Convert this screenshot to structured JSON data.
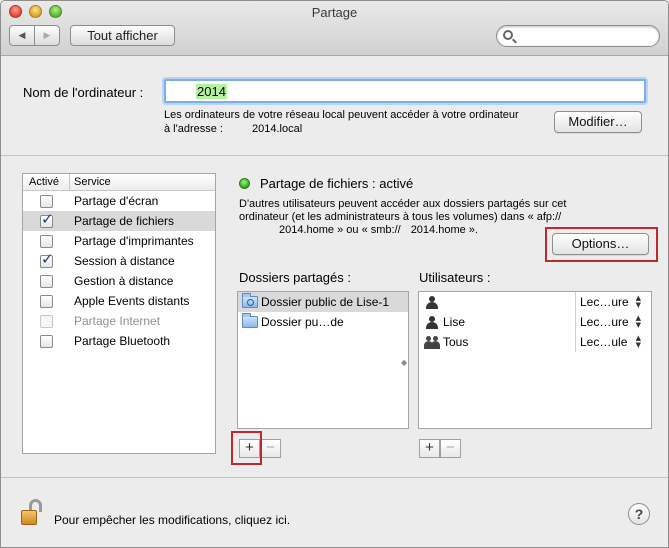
{
  "window": {
    "title": "Partage",
    "nav_back": "◀",
    "nav_forward": "▶",
    "show_all_label": "Tout afficher",
    "search_placeholder": ""
  },
  "computer_name": {
    "label": "Nom de l'ordinateur :",
    "value": "2014",
    "description": "Les ordinateurs de votre réseau local peuvent accéder à votre ordinateur à l'adresse :",
    "address": "2014.local",
    "modify_label": "Modifier…"
  },
  "services": {
    "col_active": "Activé",
    "col_service": "Service",
    "items": [
      {
        "label": "Partage d'écran",
        "checked": false,
        "selected": false,
        "disabled": false
      },
      {
        "label": "Partage de fichiers",
        "checked": true,
        "selected": true,
        "disabled": false
      },
      {
        "label": "Partage d'imprimantes",
        "checked": false,
        "selected": false,
        "disabled": false
      },
      {
        "label": "Session à distance",
        "checked": true,
        "selected": false,
        "disabled": false
      },
      {
        "label": "Gestion à distance",
        "checked": false,
        "selected": false,
        "disabled": false
      },
      {
        "label": "Apple Events distants",
        "checked": false,
        "selected": false,
        "disabled": false
      },
      {
        "label": "Partage Internet",
        "checked": false,
        "selected": false,
        "disabled": true
      },
      {
        "label": "Partage Bluetooth",
        "checked": false,
        "selected": false,
        "disabled": false
      }
    ]
  },
  "file_sharing": {
    "status": "Partage de fichiers : activé",
    "status_color": "#2ea81c",
    "description_line1": "D'autres utilisateurs peuvent accéder aux dossiers partagés sur cet",
    "description_line2": "ordinateur (et les administrateurs à tous les volumes) dans « afp://",
    "description_line3_a": "2014.home » ou « smb://",
    "description_line3_b": "2014.home ».",
    "options_label": "Options…"
  },
  "shared_folders": {
    "label": "Dossiers partagés :",
    "items": [
      {
        "name": "Dossier public de Lise-1",
        "selected": true,
        "icon": "public-folder-icon"
      },
      {
        "name": "Dossier pu…de",
        "selected": false,
        "icon": "folder-icon"
      }
    ],
    "add_label": "+",
    "remove_label": "−"
  },
  "users": {
    "label": "Utilisateurs :",
    "items": [
      {
        "name": "",
        "permission": "Lec…ure",
        "icon": "person-icon"
      },
      {
        "name": "Lise",
        "permission": "Lec…ure",
        "icon": "person-icon"
      },
      {
        "name": "Tous",
        "permission": "Lec…ule",
        "icon": "group-icon"
      }
    ],
    "add_label": "+",
    "remove_label": "−"
  },
  "footer": {
    "lock_text": "Pour empêcher les modifications, cliquez ici.",
    "help_label": "?"
  },
  "colors": {
    "highlight": "#c1272d",
    "selection_green": "#b5f2a0",
    "focus_ring": "#7eaee8"
  }
}
